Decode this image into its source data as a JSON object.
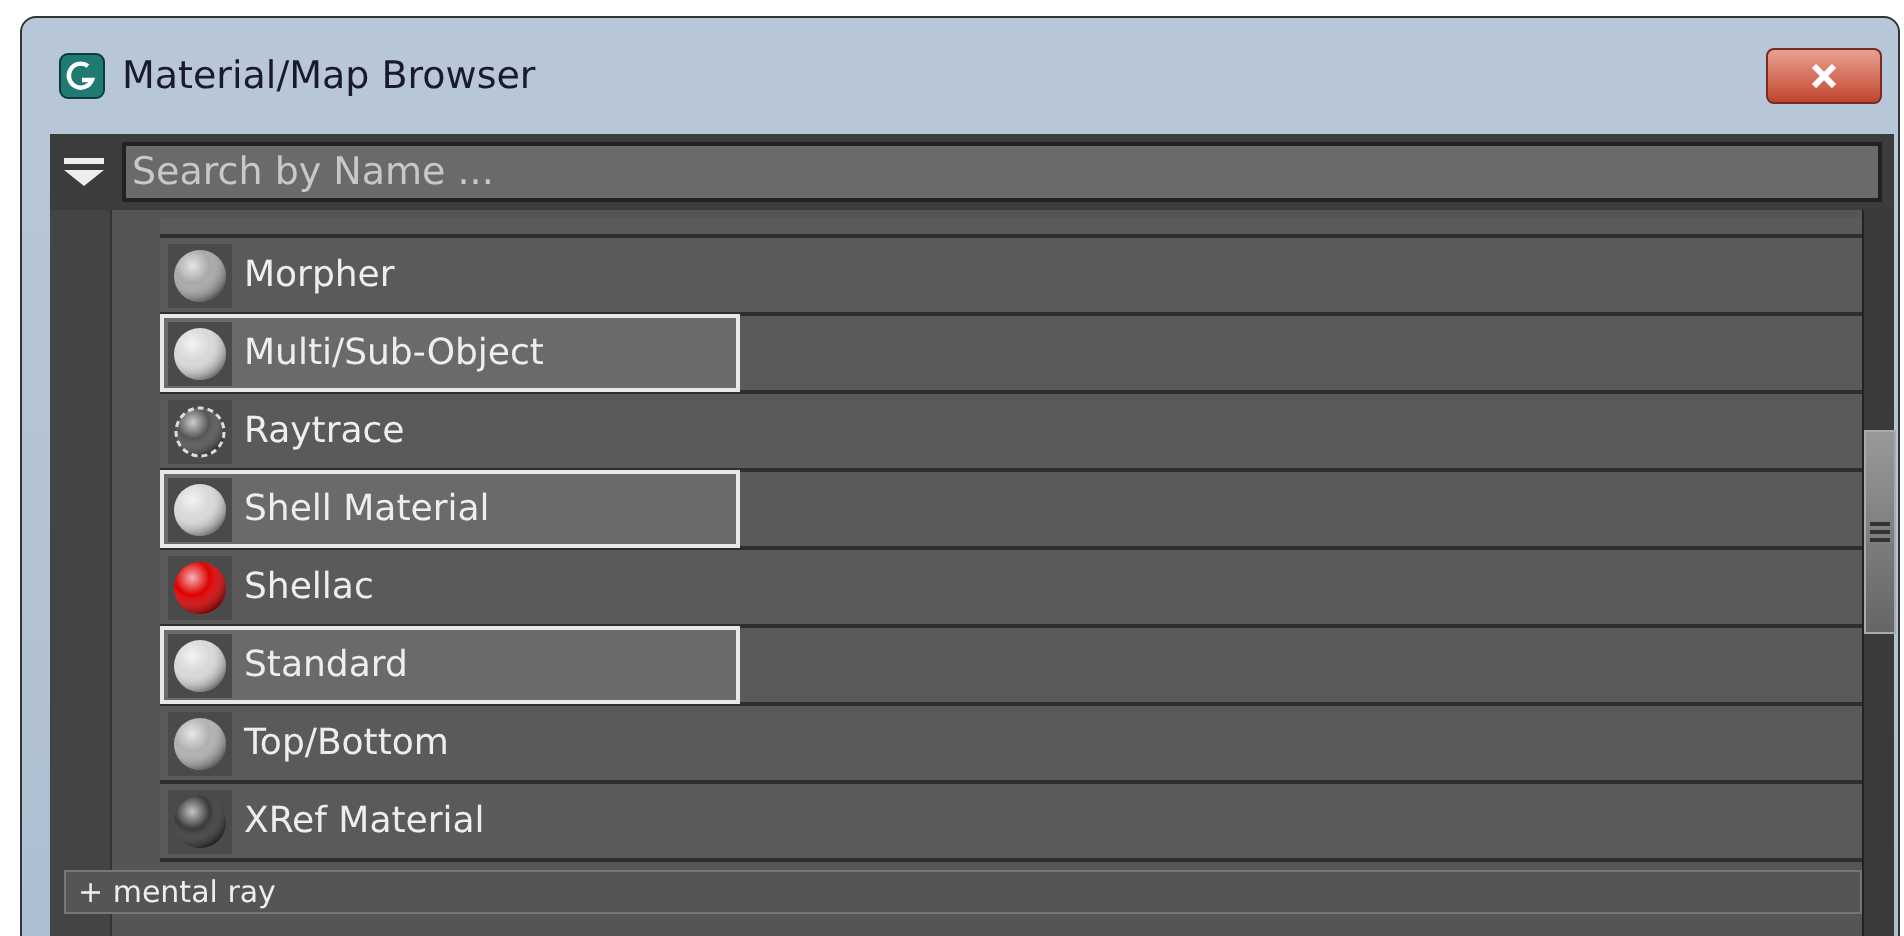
{
  "window": {
    "title": "Material/Map Browser"
  },
  "search": {
    "placeholder": "Search by Name ..."
  },
  "items": [
    {
      "label": "Morpher",
      "selected": false,
      "kind": "sphere",
      "color": "#a8a8a8"
    },
    {
      "label": "Multi/Sub-Object",
      "selected": true,
      "kind": "sphere",
      "color": "#d8d8d8"
    },
    {
      "label": "Raytrace",
      "selected": false,
      "kind": "raytrace",
      "color": "#555555"
    },
    {
      "label": "Shell Material",
      "selected": true,
      "kind": "sphere",
      "color": "#d8d8d8"
    },
    {
      "label": "Shellac",
      "selected": false,
      "kind": "sphere",
      "color": "#dd0000"
    },
    {
      "label": "Standard",
      "selected": true,
      "kind": "sphere",
      "color": "#d8d8d8"
    },
    {
      "label": "Top/Bottom",
      "selected": false,
      "kind": "sphere",
      "color": "#b0b0b0"
    },
    {
      "label": "XRef Material",
      "selected": false,
      "kind": "sphere",
      "color": "#3a3a3a"
    }
  ],
  "group": {
    "label": "+ mental ray"
  }
}
